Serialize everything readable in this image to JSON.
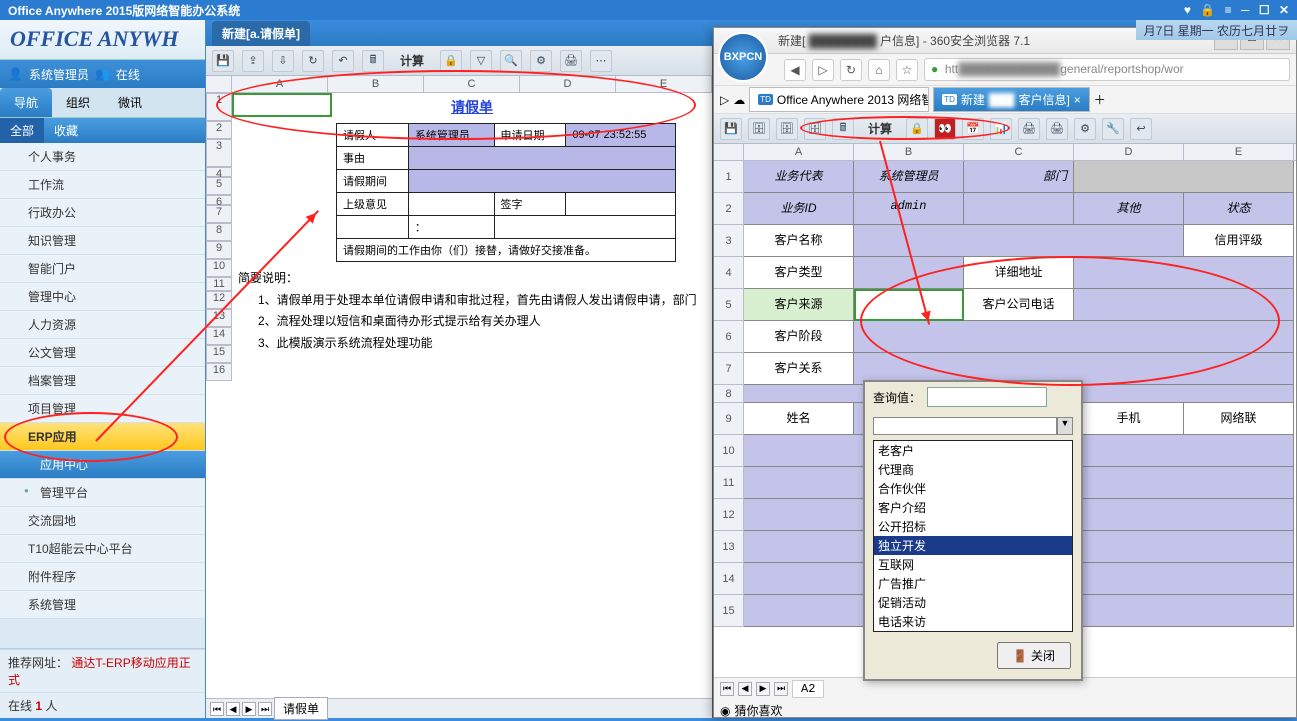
{
  "app_title": "Office Anywhere 2015版网络智能办公系统",
  "top_right_date": "月7日 星期一 农历七月廿ヲ",
  "sidebar": {
    "logo": "OFFICE ANYWH",
    "user": "系统管理员",
    "status": "在线",
    "nav_tabs": [
      "导航",
      "组织",
      "微讯"
    ],
    "sub_tabs": [
      "全部",
      "收藏"
    ],
    "menu": [
      "个人事务",
      "工作流",
      "行政办公",
      "知识管理",
      "智能门户",
      "管理中心",
      "人力资源",
      "公文管理",
      "档案管理",
      "项目管理",
      "ERP应用",
      "应用中心",
      "管理平台",
      "交流园地",
      "T10超能云中心平台",
      "附件程序",
      "系统管理"
    ],
    "footer_label": "推荐网址：",
    "footer_link": "通达T-ERP移动应用正式",
    "online_label": "在线",
    "online_count": "1",
    "online_suffix": "人"
  },
  "workspace": {
    "tab": "新建[a.请假单]"
  },
  "sheet1": {
    "toolbar_calc": "计算",
    "cols": [
      "A",
      "B",
      "C",
      "D",
      "E"
    ],
    "title": "请假单",
    "form": {
      "r1c1": "请假人",
      "r1c2": "系统管理员",
      "r1c3": "申请日期",
      "r1c4": "09-07 23:52:55",
      "r2c1": "事由",
      "r3c1": "请假期间",
      "r4c1": "上级意见",
      "r4c3": "签字",
      "r5c2": "：",
      "r6": "请假期间的工作由你（们）接替，请做好交接准备。"
    },
    "notes_title": "简要说明：",
    "notes": [
      "1、请假单用于处理本单位请假申请和审批过程，首先由请假人发出请假申请，部门",
      "2、流程处理以短信和桌面待办形式提示给有关办理人",
      "3、此模版演示系统流程处理功能"
    ],
    "sheet_tab": "请假单"
  },
  "browser": {
    "title_prefix": "新建[",
    "title_suffix": "户信息] - 360安全浏览器 7.1",
    "logo": "BXPCN",
    "url_prefix": "htt",
    "url_suffix": "general/reportshop/wor",
    "tab1": "Office Anywhere 2013 网络智…",
    "tab2_prefix": "新建",
    "tab2_suffix": "客户信息]",
    "toolbar_calc": "计算",
    "cols": [
      "A",
      "B",
      "C",
      "D",
      "E"
    ],
    "grid": {
      "r1a": "业务代表",
      "r1b": "系统管理员",
      "r1c": "部门",
      "r2a": "业务ID",
      "r2b": "admin",
      "r2d": "其他",
      "r2e": "状态",
      "r3a": "客户名称",
      "r3e": "信用评级",
      "r4a": "客户类型",
      "r4c": "详细地址",
      "r5a": "客户来源",
      "r5c": "客户公司电话",
      "r6a": "客户阶段",
      "r7a": "客户关系",
      "r9a": "姓名",
      "r9d": "手机",
      "r9e": "网络联"
    },
    "cell_ref": "A2",
    "status_like": "猜你喜欢"
  },
  "dropdown": {
    "query_label": "查询值：",
    "options": [
      "老客户",
      "代理商",
      "合作伙伴",
      "客户介绍",
      "公开招标",
      "独立开发",
      "互联网",
      "广告推广",
      "促销活动",
      "电话来访"
    ],
    "selected_index": 5,
    "close_btn": "关闭"
  }
}
